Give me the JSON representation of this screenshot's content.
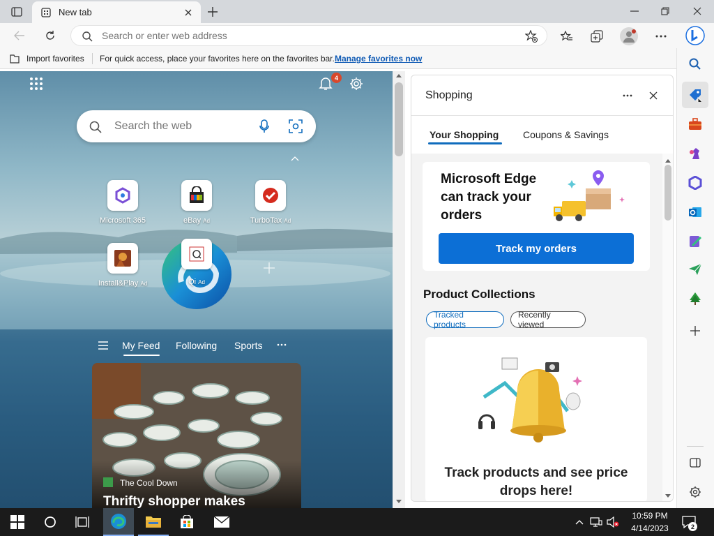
{
  "tab": {
    "title": "New tab"
  },
  "address_bar": {
    "placeholder": "Search or enter web address"
  },
  "favorites_bar": {
    "import_label": "Import favorites",
    "message": "For quick access, place your favorites here on the favorites bar.",
    "manage_link": "Manage favorites now"
  },
  "ntp": {
    "notification_count": "4",
    "search_placeholder": "Search the web",
    "quick_links": [
      {
        "label": "Microsoft 365",
        "ad": ""
      },
      {
        "label": "eBay",
        "ad": "Ad"
      },
      {
        "label": "TurboTax",
        "ad": "Ad"
      },
      {
        "label": "Install&Play",
        "ad": "Ad"
      },
      {
        "label": "Qi",
        "ad": "Ad"
      }
    ],
    "feed_tabs": [
      "My Feed",
      "Following",
      "Sports"
    ],
    "card": {
      "source": "The Cool Down",
      "headline": "Thrifty shopper makes"
    }
  },
  "shopping": {
    "title": "Shopping",
    "tabs": [
      "Your Shopping",
      "Coupons & Savings"
    ],
    "promo_title": "Microsoft Edge can track your orders",
    "promo_button": "Track my orders",
    "collections_title": "Product Collections",
    "pills": [
      "Tracked products",
      "Recently viewed"
    ],
    "track_text": "Track products and see price drops here!"
  },
  "taskbar": {
    "time": "10:59 PM",
    "date": "4/14/2023",
    "notifications": "2"
  },
  "colors": {
    "accent": "#0f6cbd",
    "button": "#0c6fd6",
    "link": "#0f5ab4"
  }
}
